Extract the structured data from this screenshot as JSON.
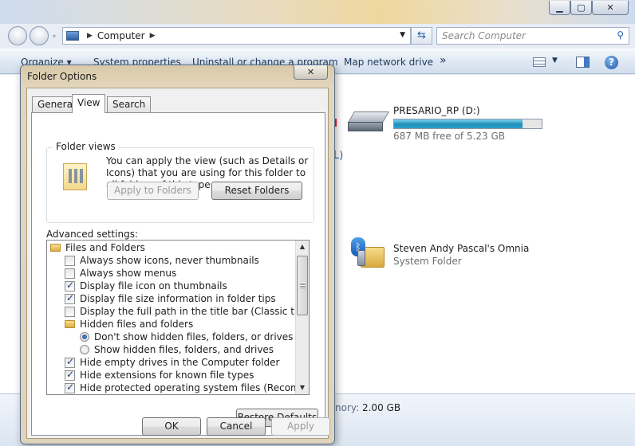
{
  "explorer": {
    "address": {
      "crumbs": [
        "Computer"
      ]
    },
    "search_placeholder": "Search Computer",
    "commands": {
      "organize": "Organize ▾",
      "system_properties": "System properties",
      "uninstall": "Uninstall or change a program",
      "map_network": "Map network drive",
      "more": "»"
    },
    "drive": {
      "name": "PRESARIO_RP (D:)",
      "free_text": "687 MB free of 5.23 GB",
      "used_fraction": 0.87
    },
    "device": {
      "name": "Steven Andy Pascal's Omnia",
      "type": "System Folder"
    },
    "fragments": {
      "paren": "L)"
    },
    "details": {
      "memory_label": "nory:",
      "memory_value": "2.00 GB"
    }
  },
  "dialog": {
    "title": "Folder Options",
    "close_glyph": "✕",
    "tabs": [
      {
        "label": "General",
        "active": false
      },
      {
        "label": "View",
        "active": true
      },
      {
        "label": "Search",
        "active": false
      }
    ],
    "folder_views": {
      "title": "Folder views",
      "description": "You can apply the view (such as Details or Icons) that you are using for this folder to all folders of this type.",
      "apply_button": "Apply to Folders",
      "reset_button": "Reset Folders"
    },
    "advanced": {
      "label": "Advanced settings:",
      "items": [
        {
          "kind": "folder",
          "label": "Files and Folders",
          "checked": null
        },
        {
          "kind": "check",
          "label": "Always show icons, never thumbnails",
          "checked": false
        },
        {
          "kind": "check",
          "label": "Always show menus",
          "checked": false
        },
        {
          "kind": "check",
          "label": "Display file icon on thumbnails",
          "checked": true
        },
        {
          "kind": "check",
          "label": "Display file size information in folder tips",
          "checked": true
        },
        {
          "kind": "check",
          "label": "Display the full path in the title bar (Classic theme only)",
          "checked": false
        },
        {
          "kind": "folder",
          "label": "Hidden files and folders",
          "checked": null
        },
        {
          "kind": "radio",
          "label": "Don't show hidden files, folders, or drives",
          "checked": true
        },
        {
          "kind": "radio",
          "label": "Show hidden files, folders, and drives",
          "checked": false
        },
        {
          "kind": "check",
          "label": "Hide empty drives in the Computer folder",
          "checked": true
        },
        {
          "kind": "check",
          "label": "Hide extensions for known file types",
          "checked": true
        },
        {
          "kind": "check",
          "label": "Hide protected operating system files (Recommended)",
          "checked": true
        }
      ]
    },
    "restore_defaults": "Restore Defaults",
    "ok": "OK",
    "cancel": "Cancel",
    "apply": "Apply"
  }
}
